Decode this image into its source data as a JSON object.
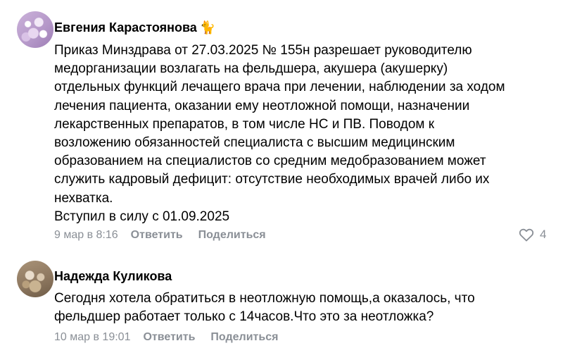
{
  "comments": [
    {
      "author": "Евгения Карастоянова",
      "author_emoji": "🐈",
      "text": "Приказ Минздрава от 27.03.2025 № 155н разрешает руководителю\nмедорганизации возлагать на фельдшера, акушера (акушерку)\nотдельных функций лечащего врача при лечении, наблюдении за ходом\nлечения пациента, оказании ему неотложной помощи, назначении\nлекарственных препаратов, в том числе НС и ПВ. Поводом к\nвозложению обязанностей специалиста с высшим медицинским\nобразованием на специалистов со средним медобразованием может\nслужить кадровый дефицит: отсутствие необходимых врачей либо их\nнехватка.\nВступил в силу с 01.09.2025",
      "date": "9 мар в 8:16",
      "reply_label": "Ответить",
      "share_label": "Поделиться",
      "likes": "4",
      "like_icon": "heart-icon"
    },
    {
      "author": "Надежда Куликова",
      "text": "Сегодня хотела обратиться в неотложную помощь,а оказалось, что\nфельдшер работает только с 14часов.Что это за неотложка?",
      "date": "10 мар в 19:01",
      "reply_label": "Ответить",
      "share_label": "Поделиться"
    }
  ],
  "colors": {
    "meta": "#8a8f96",
    "text": "#000000"
  }
}
